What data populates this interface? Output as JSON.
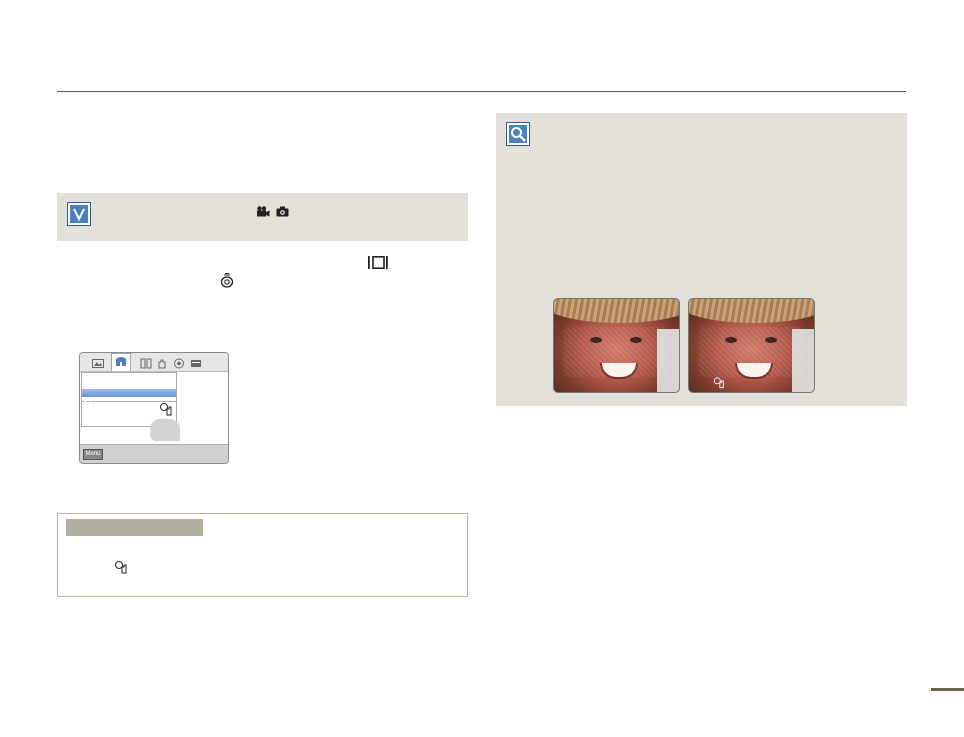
{
  "icons": {
    "check": "checkbox-tick-icon",
    "movie_mode": "movie-camera-icon",
    "photo_mode": "still-camera-icon",
    "display_button": "display-button-icon",
    "joystick": "joystick-icon",
    "face_detection": "face-detection-icon",
    "magnifier": "magnifier-tip-icon"
  },
  "lcd": {
    "menu_button": "Menu"
  },
  "colors": {
    "panel_bg": "#e2e0d8",
    "accent_blue": "#4a7fc4",
    "note_header": "#b3af9e",
    "rule": "#555555"
  }
}
